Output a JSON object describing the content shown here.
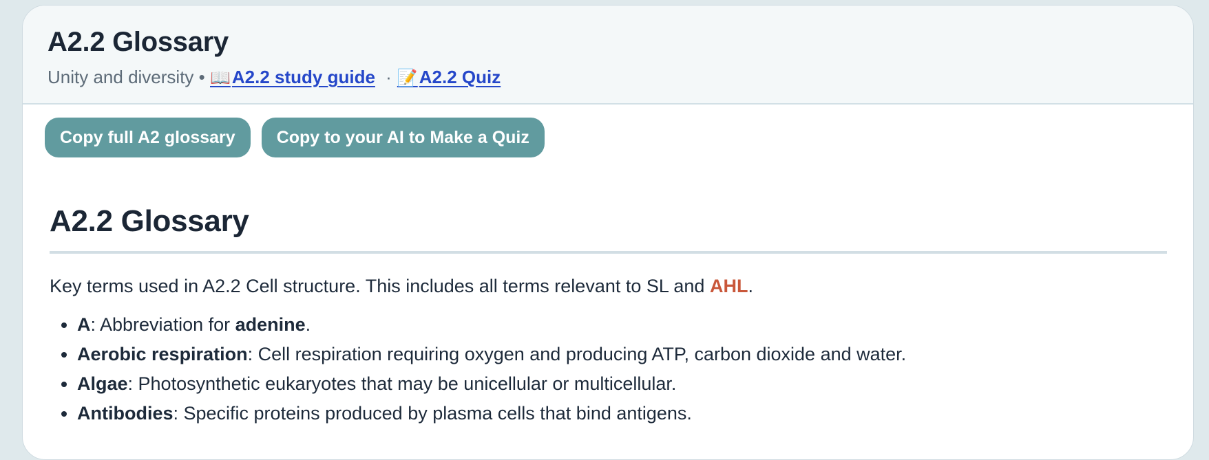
{
  "header": {
    "title": "A2.2 Glossary",
    "subtitle_text": "Unity and diversity",
    "bullet": "•",
    "dot": "·",
    "study_guide_emoji": "📖",
    "study_guide_link": "A2.2 study guide",
    "quiz_emoji": "📝",
    "quiz_link": "A2.2 Quiz"
  },
  "buttons": {
    "copy_glossary": "Copy full A2 glossary",
    "copy_ai_quiz": "Copy to your AI to Make a Quiz"
  },
  "content": {
    "heading": "A2.2 Glossary",
    "intro_before": "Key terms used in A2.2 Cell structure. This includes all terms relevant to SL and ",
    "intro_highlight": "AHL",
    "intro_after": ".",
    "terms": [
      {
        "term": "A",
        "def_before": ": Abbreviation for ",
        "def_bold": "adenine",
        "def_after": "."
      },
      {
        "term": "Aerobic respiration",
        "def": ": Cell respiration requiring oxygen and producing ATP, carbon dioxide and water."
      },
      {
        "term": "Algae",
        "def": ": Photosynthetic eukaryotes that may be unicellular or multicellular."
      },
      {
        "term": "Antibodies",
        "def": ": Specific proteins produced by plasma cells that bind antigens."
      }
    ]
  },
  "colors": {
    "page_background": "#dfe9ec",
    "header_background": "#f4f8f9",
    "button": "#619b9f",
    "link": "#2547c9",
    "ahl_highlight": "#c9573a"
  }
}
